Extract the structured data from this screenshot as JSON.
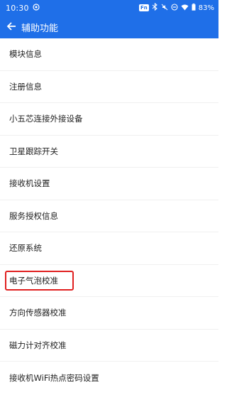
{
  "status_bar": {
    "time": "10:30",
    "fn_badge": "Fn",
    "battery": "83%",
    "bg_color": "#1f6fe8"
  },
  "app_bar": {
    "title": "辅助功能",
    "back_icon": "arrow-left-icon"
  },
  "menu": {
    "items": [
      {
        "label": "模块信息"
      },
      {
        "label": "注册信息"
      },
      {
        "label": "小五芯连接外接设备"
      },
      {
        "label": "卫星跟踪开关"
      },
      {
        "label": "接收机设置"
      },
      {
        "label": "服务授权信息"
      },
      {
        "label": "还原系统"
      },
      {
        "label": "电子气泡校准",
        "highlighted": true,
        "highlight_color": "#e02020"
      },
      {
        "label": "方向传感器校准"
      },
      {
        "label": "磁力计对齐校准"
      },
      {
        "label": "接收机WiFi热点密码设置"
      }
    ]
  }
}
